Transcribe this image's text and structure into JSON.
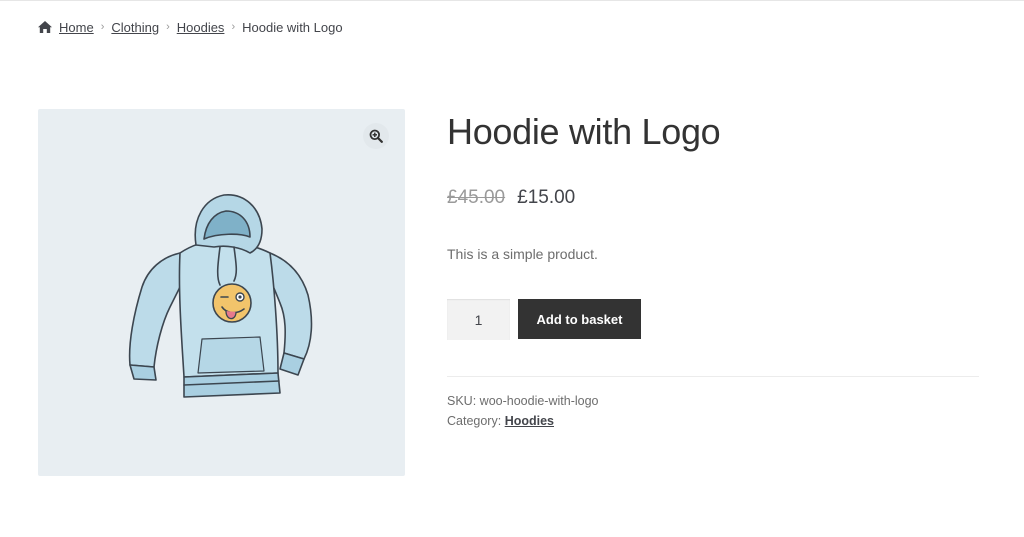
{
  "breadcrumb": {
    "home_icon": "home-icon",
    "items": [
      "Home",
      "Clothing",
      "Hoodies"
    ],
    "current": "Hoodie with Logo"
  },
  "gallery": {
    "zoom_icon": "zoom-in-icon",
    "image_alt": "hoodie-with-logo-illustration"
  },
  "product": {
    "title": "Hoodie with Logo",
    "regular_price": "£45.00",
    "sale_price": "£15.00",
    "short_description": "This is a simple product.",
    "quantity": "1",
    "add_to_cart_label": "Add to basket",
    "sku_label": "SKU:",
    "sku": "woo-hoodie-with-logo",
    "category_label": "Category:",
    "category": "Hoodies"
  },
  "colors": {
    "button_bg": "#333333",
    "gallery_bg": "#e8eef2",
    "hoodie": "#bcdbe9",
    "emoji": "#f2c46b"
  }
}
